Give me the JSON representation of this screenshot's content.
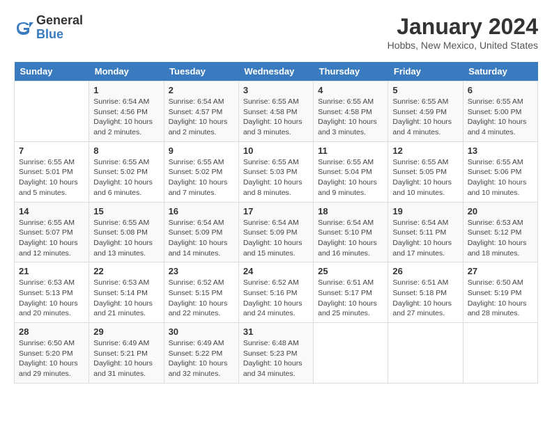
{
  "logo": {
    "general": "General",
    "blue": "Blue"
  },
  "title": "January 2024",
  "subtitle": "Hobbs, New Mexico, United States",
  "weekdays": [
    "Sunday",
    "Monday",
    "Tuesday",
    "Wednesday",
    "Thursday",
    "Friday",
    "Saturday"
  ],
  "weeks": [
    [
      {
        "day": "",
        "info": ""
      },
      {
        "day": "1",
        "info": "Sunrise: 6:54 AM\nSunset: 4:56 PM\nDaylight: 10 hours\nand 2 minutes."
      },
      {
        "day": "2",
        "info": "Sunrise: 6:54 AM\nSunset: 4:57 PM\nDaylight: 10 hours\nand 2 minutes."
      },
      {
        "day": "3",
        "info": "Sunrise: 6:55 AM\nSunset: 4:58 PM\nDaylight: 10 hours\nand 3 minutes."
      },
      {
        "day": "4",
        "info": "Sunrise: 6:55 AM\nSunset: 4:58 PM\nDaylight: 10 hours\nand 3 minutes."
      },
      {
        "day": "5",
        "info": "Sunrise: 6:55 AM\nSunset: 4:59 PM\nDaylight: 10 hours\nand 4 minutes."
      },
      {
        "day": "6",
        "info": "Sunrise: 6:55 AM\nSunset: 5:00 PM\nDaylight: 10 hours\nand 4 minutes."
      }
    ],
    [
      {
        "day": "7",
        "info": "Sunrise: 6:55 AM\nSunset: 5:01 PM\nDaylight: 10 hours\nand 5 minutes."
      },
      {
        "day": "8",
        "info": "Sunrise: 6:55 AM\nSunset: 5:02 PM\nDaylight: 10 hours\nand 6 minutes."
      },
      {
        "day": "9",
        "info": "Sunrise: 6:55 AM\nSunset: 5:02 PM\nDaylight: 10 hours\nand 7 minutes."
      },
      {
        "day": "10",
        "info": "Sunrise: 6:55 AM\nSunset: 5:03 PM\nDaylight: 10 hours\nand 8 minutes."
      },
      {
        "day": "11",
        "info": "Sunrise: 6:55 AM\nSunset: 5:04 PM\nDaylight: 10 hours\nand 9 minutes."
      },
      {
        "day": "12",
        "info": "Sunrise: 6:55 AM\nSunset: 5:05 PM\nDaylight: 10 hours\nand 10 minutes."
      },
      {
        "day": "13",
        "info": "Sunrise: 6:55 AM\nSunset: 5:06 PM\nDaylight: 10 hours\nand 10 minutes."
      }
    ],
    [
      {
        "day": "14",
        "info": "Sunrise: 6:55 AM\nSunset: 5:07 PM\nDaylight: 10 hours\nand 12 minutes."
      },
      {
        "day": "15",
        "info": "Sunrise: 6:55 AM\nSunset: 5:08 PM\nDaylight: 10 hours\nand 13 minutes."
      },
      {
        "day": "16",
        "info": "Sunrise: 6:54 AM\nSunset: 5:09 PM\nDaylight: 10 hours\nand 14 minutes."
      },
      {
        "day": "17",
        "info": "Sunrise: 6:54 AM\nSunset: 5:09 PM\nDaylight: 10 hours\nand 15 minutes."
      },
      {
        "day": "18",
        "info": "Sunrise: 6:54 AM\nSunset: 5:10 PM\nDaylight: 10 hours\nand 16 minutes."
      },
      {
        "day": "19",
        "info": "Sunrise: 6:54 AM\nSunset: 5:11 PM\nDaylight: 10 hours\nand 17 minutes."
      },
      {
        "day": "20",
        "info": "Sunrise: 6:53 AM\nSunset: 5:12 PM\nDaylight: 10 hours\nand 18 minutes."
      }
    ],
    [
      {
        "day": "21",
        "info": "Sunrise: 6:53 AM\nSunset: 5:13 PM\nDaylight: 10 hours\nand 20 minutes."
      },
      {
        "day": "22",
        "info": "Sunrise: 6:53 AM\nSunset: 5:14 PM\nDaylight: 10 hours\nand 21 minutes."
      },
      {
        "day": "23",
        "info": "Sunrise: 6:52 AM\nSunset: 5:15 PM\nDaylight: 10 hours\nand 22 minutes."
      },
      {
        "day": "24",
        "info": "Sunrise: 6:52 AM\nSunset: 5:16 PM\nDaylight: 10 hours\nand 24 minutes."
      },
      {
        "day": "25",
        "info": "Sunrise: 6:51 AM\nSunset: 5:17 PM\nDaylight: 10 hours\nand 25 minutes."
      },
      {
        "day": "26",
        "info": "Sunrise: 6:51 AM\nSunset: 5:18 PM\nDaylight: 10 hours\nand 27 minutes."
      },
      {
        "day": "27",
        "info": "Sunrise: 6:50 AM\nSunset: 5:19 PM\nDaylight: 10 hours\nand 28 minutes."
      }
    ],
    [
      {
        "day": "28",
        "info": "Sunrise: 6:50 AM\nSunset: 5:20 PM\nDaylight: 10 hours\nand 29 minutes."
      },
      {
        "day": "29",
        "info": "Sunrise: 6:49 AM\nSunset: 5:21 PM\nDaylight: 10 hours\nand 31 minutes."
      },
      {
        "day": "30",
        "info": "Sunrise: 6:49 AM\nSunset: 5:22 PM\nDaylight: 10 hours\nand 32 minutes."
      },
      {
        "day": "31",
        "info": "Sunrise: 6:48 AM\nSunset: 5:23 PM\nDaylight: 10 hours\nand 34 minutes."
      },
      {
        "day": "",
        "info": ""
      },
      {
        "day": "",
        "info": ""
      },
      {
        "day": "",
        "info": ""
      }
    ]
  ]
}
